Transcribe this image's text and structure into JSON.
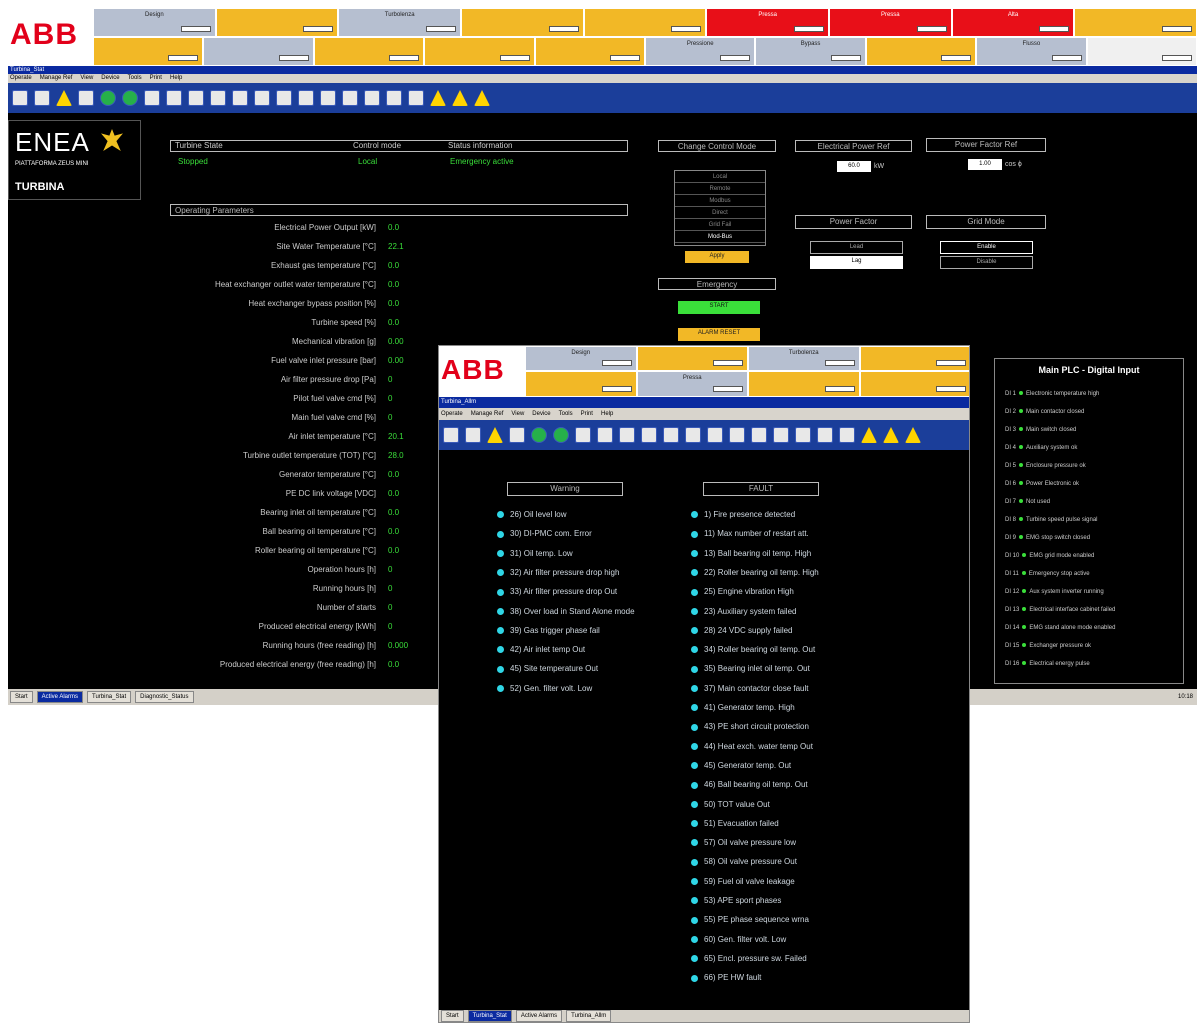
{
  "main_window": {
    "brand": "ABB",
    "header_top": [
      {
        "label": "Design",
        "color": "gray"
      },
      {
        "label": "",
        "color": "yel"
      },
      {
        "label": "Turbolenza",
        "color": "gray"
      },
      {
        "label": "",
        "color": "yel"
      },
      {
        "label": "",
        "color": "yel"
      },
      {
        "label": "Pressa",
        "color": "red"
      },
      {
        "label": "Pressa",
        "color": "red"
      },
      {
        "label": "Alta",
        "color": "red"
      },
      {
        "label": "",
        "color": "yel"
      }
    ],
    "header_bottom": [
      {
        "label": "",
        "color": "yel"
      },
      {
        "label": "",
        "color": "gray"
      },
      {
        "label": "",
        "color": "yel"
      },
      {
        "label": "",
        "color": "yel"
      },
      {
        "label": "",
        "color": "yel"
      },
      {
        "label": "Pressione",
        "color": "gray"
      },
      {
        "label": "Bypass",
        "color": "gray"
      },
      {
        "label": "",
        "color": "yel"
      },
      {
        "label": "Flusso",
        "color": "gray"
      },
      {
        "label": "",
        "color": "white"
      }
    ],
    "title": "Turbina_Stat",
    "menu": [
      "Operate",
      "Manage Ref",
      "View",
      "Device",
      "Tools",
      "Print",
      "Help"
    ],
    "enea": {
      "logo": "ENEA",
      "subtitle": "PIATTAFORMA ZEUS MINI",
      "section": "TURBINA"
    },
    "status": {
      "turbine_state_label": "Turbine State",
      "turbine_state_value": "Stopped",
      "control_mode_label": "Control mode",
      "control_mode_value": "Local",
      "status_info_label": "Status information",
      "status_info_value": "Emergency active"
    },
    "operating_title": "Operating Parameters",
    "parameters": [
      {
        "label": "Electrical Power Output [kW]",
        "value": "0.0"
      },
      {
        "label": "Site Water Temperature [°C]",
        "value": "22.1"
      },
      {
        "label": "Exhaust gas temperature [°C]",
        "value": "0.0"
      },
      {
        "label": "Heat exchanger outlet water temperature [°C]",
        "value": "0.0"
      },
      {
        "label": "Heat exchanger bypass position [%]",
        "value": "0.0"
      },
      {
        "label": "Turbine speed [%]",
        "value": "0.0"
      },
      {
        "label": "Mechanical vibration [g]",
        "value": "0.00"
      },
      {
        "label": "Fuel valve inlet pressure [bar]",
        "value": "0.00"
      },
      {
        "label": "Air filter pressure drop [Pa]",
        "value": "0"
      },
      {
        "label": "Pilot fuel valve cmd [%]",
        "value": "0"
      },
      {
        "label": "Main fuel valve cmd [%]",
        "value": "0"
      },
      {
        "label": "Air inlet temperature [°C]",
        "value": "20.1"
      },
      {
        "label": "Turbine outlet temperature (TOT) [°C]",
        "value": "28.0"
      },
      {
        "label": "Generator temperature [°C]",
        "value": "0.0"
      },
      {
        "label": "PE DC link voltage [VDC]",
        "value": "0.0"
      },
      {
        "label": "Bearing inlet oil temperature [°C]",
        "value": "0.0"
      },
      {
        "label": "Ball bearing oil temperature [°C]",
        "value": "0.0"
      },
      {
        "label": "Roller bearing oil temperature [°C]",
        "value": "0.0"
      },
      {
        "label": "Operation hours [h]",
        "value": "0"
      },
      {
        "label": "Running hours [h]",
        "value": "0"
      },
      {
        "label": "Number of starts",
        "value": "0"
      },
      {
        "label": "Produced electrical energy [kWh]",
        "value": "0"
      },
      {
        "label": "Running hours (free reading) [h]",
        "value": "0.000"
      },
      {
        "label": "Produced electrical energy (free reading) [h]",
        "value": "0.0"
      }
    ],
    "change_control_mode": {
      "title": "Change Control Mode",
      "options": [
        "Local",
        "Remote",
        "Modbus",
        "Direct",
        "Grid Fail",
        "Mod-Bus"
      ],
      "button": "Apply"
    },
    "emergency": {
      "title": "Emergency",
      "start": "START",
      "alarm_reset": "ALARM RESET"
    },
    "electrical_power_ref": {
      "title": "Electrical Power Ref",
      "value": "60.0",
      "unit": "kW"
    },
    "power_factor_ref": {
      "title": "Power Factor Ref",
      "value": "1.00",
      "unit": "cos ϕ"
    },
    "power_factor": {
      "title": "Power Factor",
      "options": [
        "Lead",
        "Lag"
      ]
    },
    "grid_mode": {
      "title": "Grid Mode",
      "options": [
        "Enable",
        "Disable"
      ]
    },
    "plc": {
      "title": "Main PLC - Digital Input",
      "inputs": [
        {
          "id": "DI 1",
          "label": "Electronic temperature high"
        },
        {
          "id": "DI 2",
          "label": "Main contactor closed"
        },
        {
          "id": "DI 3",
          "label": "Main switch closed"
        },
        {
          "id": "DI 4",
          "label": "Auxiliary system ok"
        },
        {
          "id": "DI 5",
          "label": "Enclosure pressure ok"
        },
        {
          "id": "DI 6",
          "label": "Power Electronic ok"
        },
        {
          "id": "DI 7",
          "label": "Not used"
        },
        {
          "id": "DI 8",
          "label": "Turbine speed pulse signal"
        },
        {
          "id": "DI 9",
          "label": "EMG stop switch closed"
        },
        {
          "id": "DI 10",
          "label": "EMG grid mode enabled"
        },
        {
          "id": "DI 11",
          "label": "Emergency stop active"
        },
        {
          "id": "DI 12",
          "label": "Aux system inverter running"
        },
        {
          "id": "DI 13",
          "label": "Electrical interface cabinet failed"
        },
        {
          "id": "DI 14",
          "label": "EMG stand alone mode enabled"
        },
        {
          "id": "DI 15",
          "label": "Exchanger pressure ok"
        },
        {
          "id": "DI 16",
          "label": "Electrical energy pulse"
        }
      ]
    },
    "taskbar": [
      "Start",
      "Active Alarms",
      "Turbina_Stat",
      "Diagnostic_Status"
    ],
    "tray_time": "10:18"
  },
  "alarm_window": {
    "brand": "ABB",
    "title": "Turbina_Allm",
    "header_top": [
      {
        "label": "Design",
        "color": "gray"
      },
      {
        "label": "",
        "color": "yel"
      },
      {
        "label": "Turbolenza",
        "color": "gray"
      },
      {
        "label": "",
        "color": "yel"
      }
    ],
    "header_bottom": [
      {
        "label": "",
        "color": "yel"
      },
      {
        "label": "Pressa",
        "color": "gray"
      },
      {
        "label": "",
        "color": "yel"
      },
      {
        "label": "",
        "color": "yel"
      }
    ],
    "menu": [
      "Operate",
      "Manage Ref",
      "View",
      "Device",
      "Tools",
      "Print",
      "Help"
    ],
    "warning_title": "Warning",
    "fault_title": "FAULT",
    "warnings": [
      "26) Oil level low",
      "30) DI-PMC com. Error",
      "31) Oil temp. Low",
      "32) Air filter pressure drop high",
      "33) Air filter pressure drop Out",
      "38) Over load in Stand Alone mode",
      "39) Gas trigger phase fail",
      "42) Air inlet temp Out",
      "45) Site temperature Out",
      "52) Gen. filter volt. Low"
    ],
    "faults": [
      "1) Fire presence detected",
      "11) Max number of restart att.",
      "13) Ball bearing oil temp. High",
      "22) Roller bearing oil temp. High",
      "25) Engine vibration High",
      "23) Auxiliary system failed",
      "28) 24 VDC supply failed",
      "34) Roller bearing oil temp. Out",
      "35) Bearing inlet oil temp. Out",
      "37) Main contactor close fault",
      "41) Generator temp. High",
      "43) PE short circuit protection",
      "44) Heat exch. water temp Out",
      "45) Generator temp. Out",
      "46) Ball bearing oil temp. Out",
      "50) TOT value Out",
      "51) Evacuation failed",
      "57) Oil valve pressure low",
      "58) Oil valve pressure Out",
      "59) Fuel oil valve leakage",
      "53) APE sport phases",
      "55) PE phase sequence wrna",
      "60) Gen. filter volt. Low",
      "65) Encl. pressure sw. Failed",
      "66) PE HW fault"
    ],
    "taskbar": [
      "Start",
      "Turbina_Stat",
      "Active Alarms",
      "Turbina_Allm"
    ]
  }
}
